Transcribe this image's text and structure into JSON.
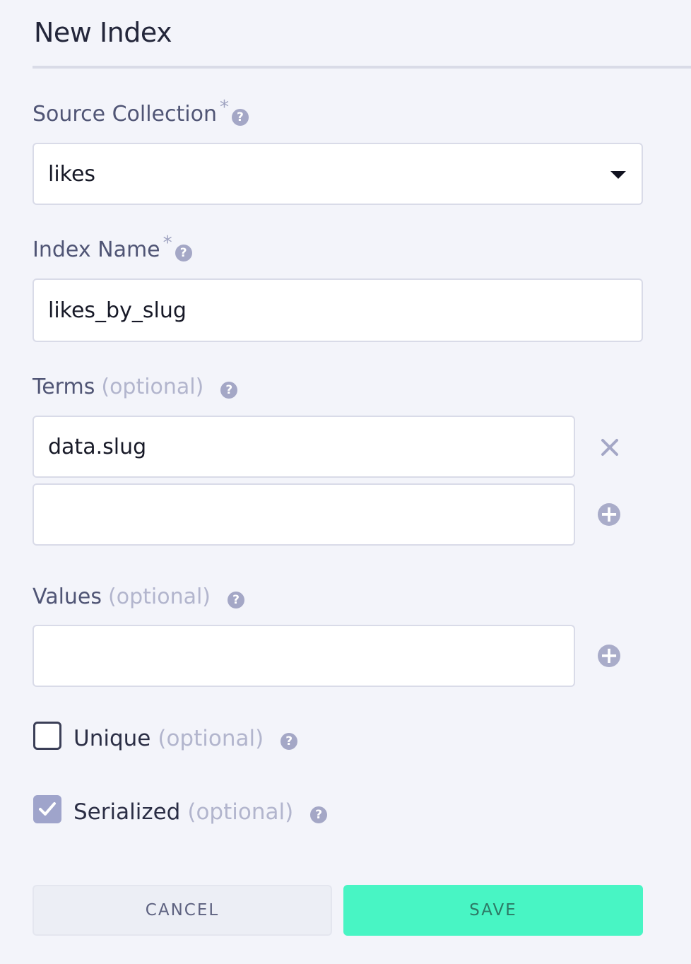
{
  "header": {
    "title": "New Index"
  },
  "form": {
    "source_collection": {
      "label": "Source Collection",
      "required_mark": "*",
      "value": "likes"
    },
    "index_name": {
      "label": "Index Name",
      "required_mark": "*",
      "value": "likes_by_slug"
    },
    "terms": {
      "label": "Terms",
      "optional": "(optional)",
      "items": [
        "data.slug",
        ""
      ]
    },
    "values": {
      "label": "Values",
      "optional": "(optional)",
      "items": [
        ""
      ]
    },
    "unique": {
      "label": "Unique",
      "optional": "(optional)",
      "checked": false
    },
    "serialized": {
      "label": "Serialized",
      "optional": "(optional)",
      "checked": true
    }
  },
  "icons": {
    "help": "question-circle-icon",
    "dropdown": "caret-down-icon",
    "remove": "close-icon",
    "add": "plus-circle-icon",
    "check": "check-icon"
  },
  "help_glyph": "?",
  "add_glyph": "+",
  "actions": {
    "cancel_label": "CANCEL",
    "save_label": "SAVE"
  },
  "colors": {
    "background": "#f3f4fa",
    "accent_save": "#48f5c4",
    "icon": "#a4a7c6",
    "checkbox_checked": "#9fa4cb"
  }
}
